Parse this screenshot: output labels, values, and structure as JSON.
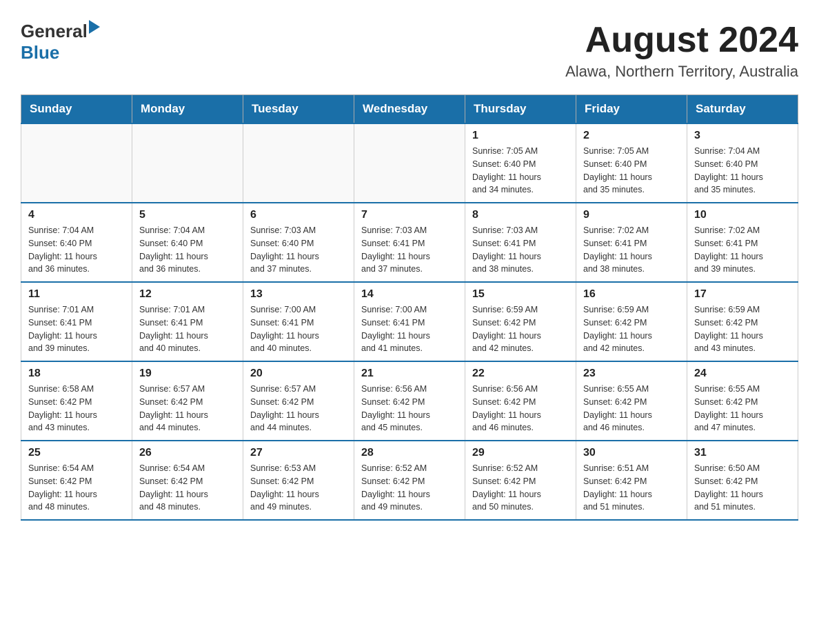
{
  "header": {
    "logo_general": "General",
    "logo_blue": "Blue",
    "month_title": "August 2024",
    "location": "Alawa, Northern Territory, Australia"
  },
  "weekdays": [
    "Sunday",
    "Monday",
    "Tuesday",
    "Wednesday",
    "Thursday",
    "Friday",
    "Saturday"
  ],
  "rows": [
    [
      {
        "day": "",
        "info": ""
      },
      {
        "day": "",
        "info": ""
      },
      {
        "day": "",
        "info": ""
      },
      {
        "day": "",
        "info": ""
      },
      {
        "day": "1",
        "info": "Sunrise: 7:05 AM\nSunset: 6:40 PM\nDaylight: 11 hours\nand 34 minutes."
      },
      {
        "day": "2",
        "info": "Sunrise: 7:05 AM\nSunset: 6:40 PM\nDaylight: 11 hours\nand 35 minutes."
      },
      {
        "day": "3",
        "info": "Sunrise: 7:04 AM\nSunset: 6:40 PM\nDaylight: 11 hours\nand 35 minutes."
      }
    ],
    [
      {
        "day": "4",
        "info": "Sunrise: 7:04 AM\nSunset: 6:40 PM\nDaylight: 11 hours\nand 36 minutes."
      },
      {
        "day": "5",
        "info": "Sunrise: 7:04 AM\nSunset: 6:40 PM\nDaylight: 11 hours\nand 36 minutes."
      },
      {
        "day": "6",
        "info": "Sunrise: 7:03 AM\nSunset: 6:40 PM\nDaylight: 11 hours\nand 37 minutes."
      },
      {
        "day": "7",
        "info": "Sunrise: 7:03 AM\nSunset: 6:41 PM\nDaylight: 11 hours\nand 37 minutes."
      },
      {
        "day": "8",
        "info": "Sunrise: 7:03 AM\nSunset: 6:41 PM\nDaylight: 11 hours\nand 38 minutes."
      },
      {
        "day": "9",
        "info": "Sunrise: 7:02 AM\nSunset: 6:41 PM\nDaylight: 11 hours\nand 38 minutes."
      },
      {
        "day": "10",
        "info": "Sunrise: 7:02 AM\nSunset: 6:41 PM\nDaylight: 11 hours\nand 39 minutes."
      }
    ],
    [
      {
        "day": "11",
        "info": "Sunrise: 7:01 AM\nSunset: 6:41 PM\nDaylight: 11 hours\nand 39 minutes."
      },
      {
        "day": "12",
        "info": "Sunrise: 7:01 AM\nSunset: 6:41 PM\nDaylight: 11 hours\nand 40 minutes."
      },
      {
        "day": "13",
        "info": "Sunrise: 7:00 AM\nSunset: 6:41 PM\nDaylight: 11 hours\nand 40 minutes."
      },
      {
        "day": "14",
        "info": "Sunrise: 7:00 AM\nSunset: 6:41 PM\nDaylight: 11 hours\nand 41 minutes."
      },
      {
        "day": "15",
        "info": "Sunrise: 6:59 AM\nSunset: 6:42 PM\nDaylight: 11 hours\nand 42 minutes."
      },
      {
        "day": "16",
        "info": "Sunrise: 6:59 AM\nSunset: 6:42 PM\nDaylight: 11 hours\nand 42 minutes."
      },
      {
        "day": "17",
        "info": "Sunrise: 6:59 AM\nSunset: 6:42 PM\nDaylight: 11 hours\nand 43 minutes."
      }
    ],
    [
      {
        "day": "18",
        "info": "Sunrise: 6:58 AM\nSunset: 6:42 PM\nDaylight: 11 hours\nand 43 minutes."
      },
      {
        "day": "19",
        "info": "Sunrise: 6:57 AM\nSunset: 6:42 PM\nDaylight: 11 hours\nand 44 minutes."
      },
      {
        "day": "20",
        "info": "Sunrise: 6:57 AM\nSunset: 6:42 PM\nDaylight: 11 hours\nand 44 minutes."
      },
      {
        "day": "21",
        "info": "Sunrise: 6:56 AM\nSunset: 6:42 PM\nDaylight: 11 hours\nand 45 minutes."
      },
      {
        "day": "22",
        "info": "Sunrise: 6:56 AM\nSunset: 6:42 PM\nDaylight: 11 hours\nand 46 minutes."
      },
      {
        "day": "23",
        "info": "Sunrise: 6:55 AM\nSunset: 6:42 PM\nDaylight: 11 hours\nand 46 minutes."
      },
      {
        "day": "24",
        "info": "Sunrise: 6:55 AM\nSunset: 6:42 PM\nDaylight: 11 hours\nand 47 minutes."
      }
    ],
    [
      {
        "day": "25",
        "info": "Sunrise: 6:54 AM\nSunset: 6:42 PM\nDaylight: 11 hours\nand 48 minutes."
      },
      {
        "day": "26",
        "info": "Sunrise: 6:54 AM\nSunset: 6:42 PM\nDaylight: 11 hours\nand 48 minutes."
      },
      {
        "day": "27",
        "info": "Sunrise: 6:53 AM\nSunset: 6:42 PM\nDaylight: 11 hours\nand 49 minutes."
      },
      {
        "day": "28",
        "info": "Sunrise: 6:52 AM\nSunset: 6:42 PM\nDaylight: 11 hours\nand 49 minutes."
      },
      {
        "day": "29",
        "info": "Sunrise: 6:52 AM\nSunset: 6:42 PM\nDaylight: 11 hours\nand 50 minutes."
      },
      {
        "day": "30",
        "info": "Sunrise: 6:51 AM\nSunset: 6:42 PM\nDaylight: 11 hours\nand 51 minutes."
      },
      {
        "day": "31",
        "info": "Sunrise: 6:50 AM\nSunset: 6:42 PM\nDaylight: 11 hours\nand 51 minutes."
      }
    ]
  ]
}
